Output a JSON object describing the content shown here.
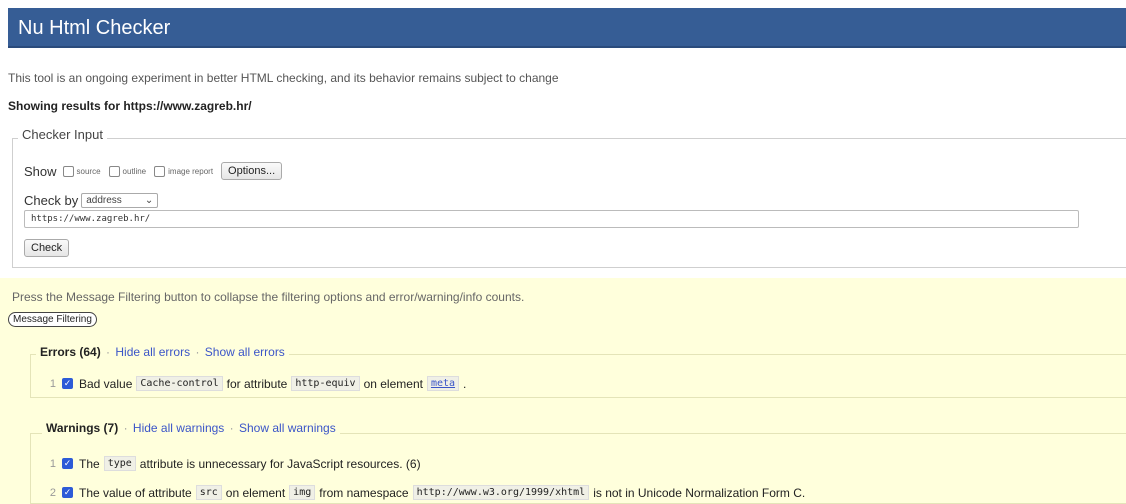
{
  "header": {
    "title": "Nu Html Checker"
  },
  "intro": "This tool is an ongoing experiment in better HTML checking, and its behavior remains subject to change",
  "showing": "Showing results for https://www.zagreb.hr/",
  "checker_input": {
    "legend": "Checker Input",
    "show_label": "Show",
    "options": [
      {
        "label": "source",
        "checked": false
      },
      {
        "label": "outline",
        "checked": false
      },
      {
        "label": "image report",
        "checked": false
      }
    ],
    "options_button": "Options...",
    "check_by_label": "Check by",
    "check_by_value": "address",
    "url_value": "https://www.zagreb.hr/",
    "check_button": "Check"
  },
  "filtering": {
    "press_text": "Press the Message Filtering button to collapse the filtering options and error/warning/info counts.",
    "button": "Message Filtering"
  },
  "errors": {
    "title": "Errors (64)",
    "hide": "Hide all errors",
    "show": "Show all errors",
    "items": [
      {
        "num": "1",
        "t1": "Bad value",
        "c1": "Cache-control",
        "t2": "for attribute",
        "c2": "http-equiv",
        "t3": "on element",
        "c3": "meta",
        "t4": "."
      }
    ]
  },
  "warnings": {
    "title": "Warnings (7)",
    "hide": "Hide all warnings",
    "show": "Show all warnings",
    "items": [
      {
        "num": "1",
        "t1": "The",
        "c1": "type",
        "t2": "attribute is unnecessary for JavaScript resources. (6)"
      },
      {
        "num": "2",
        "t1": "The value of attribute",
        "c1": "src",
        "t2": "on element",
        "c2": "img",
        "t3": "from namespace",
        "c3": "http://www.w3.org/1999/xhtml",
        "t4": "is not in Unicode Normalization Form C."
      }
    ]
  }
}
